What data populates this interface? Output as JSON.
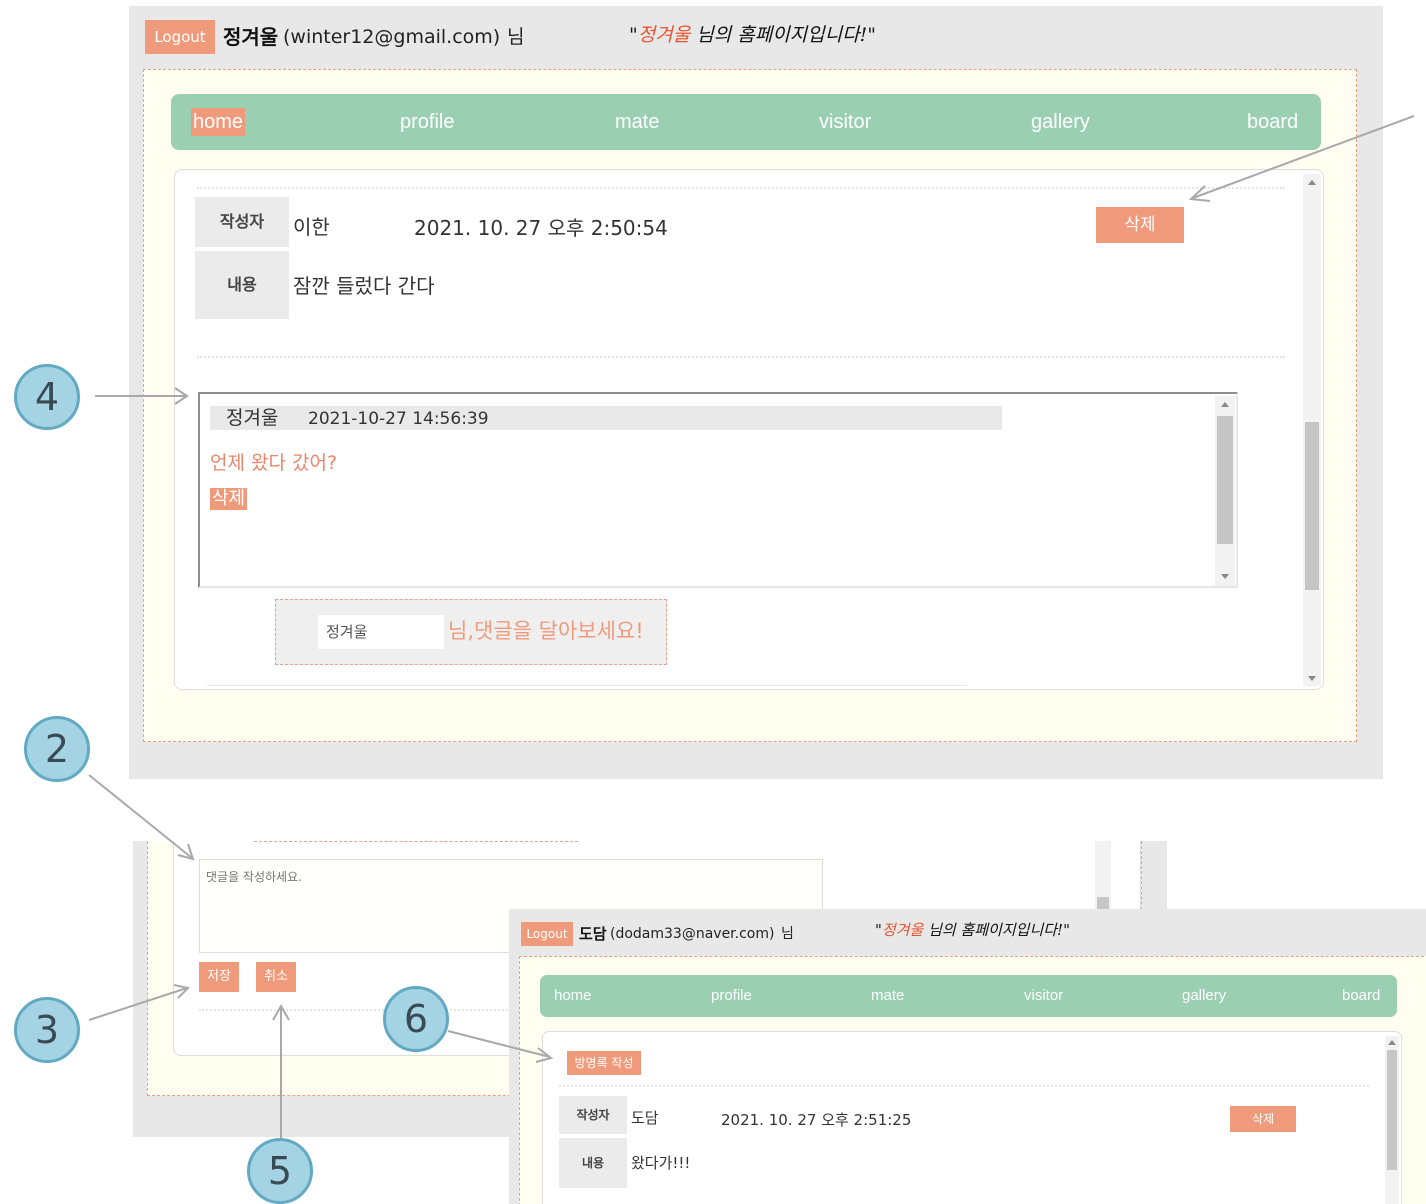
{
  "panel_main": {
    "logout_label": "Logout",
    "user_name": "정겨울",
    "user_email": "(winter12@gmail.com)",
    "user_suffix": "님",
    "greeting_quote_open": "\"",
    "greeting_name": "정겨울",
    "greeting_rest": " 님의 홈페이지입니다!\"",
    "nav": [
      "home",
      "profile",
      "mate",
      "visitor",
      "gallery",
      "board"
    ],
    "active_nav": "home",
    "post": {
      "author_label": "작성자",
      "author": "이한",
      "date": "2021. 10. 27 오후 2:50:54",
      "delete_label": "삭제",
      "content_label": "내용",
      "content": "잠깐 들렀다 간다"
    },
    "comment": {
      "author": "정겨울",
      "date": "2021-10-27 14:56:39",
      "text": "언제 왔다 갔어?",
      "delete_label": "삭제"
    },
    "reply": {
      "input_value": "정겨울",
      "hint": "님,댓글을 달아보세요!"
    }
  },
  "panel_write": {
    "textarea_placeholder": "댓글을 작성하세요.",
    "save_label": "저장",
    "cancel_label": "취소"
  },
  "panel_other": {
    "logout_label": "Logout",
    "user_name": "도담",
    "user_email": "(dodam33@naver.com)",
    "user_suffix": "님",
    "greeting_quote_open": "\"",
    "greeting_name": "정겨울",
    "greeting_rest": " 님의 홈페이지입니다!\"",
    "nav": [
      "home",
      "profile",
      "mate",
      "visitor",
      "gallery",
      "board"
    ],
    "write_label": "방명록 작성",
    "post": {
      "author_label": "작성자",
      "author": "도담",
      "date": "2021. 10. 27 오후 2:51:25",
      "delete_label": "삭제",
      "content_label": "내용",
      "content": "왔다가!!!"
    }
  },
  "callouts": [
    "4",
    "2",
    "3",
    "6",
    "5"
  ],
  "colors": {
    "accent": "#f09a7c",
    "nav": "#9bcfb2",
    "frame_bg": "#fffef0",
    "callout": "#a4d4e3"
  }
}
